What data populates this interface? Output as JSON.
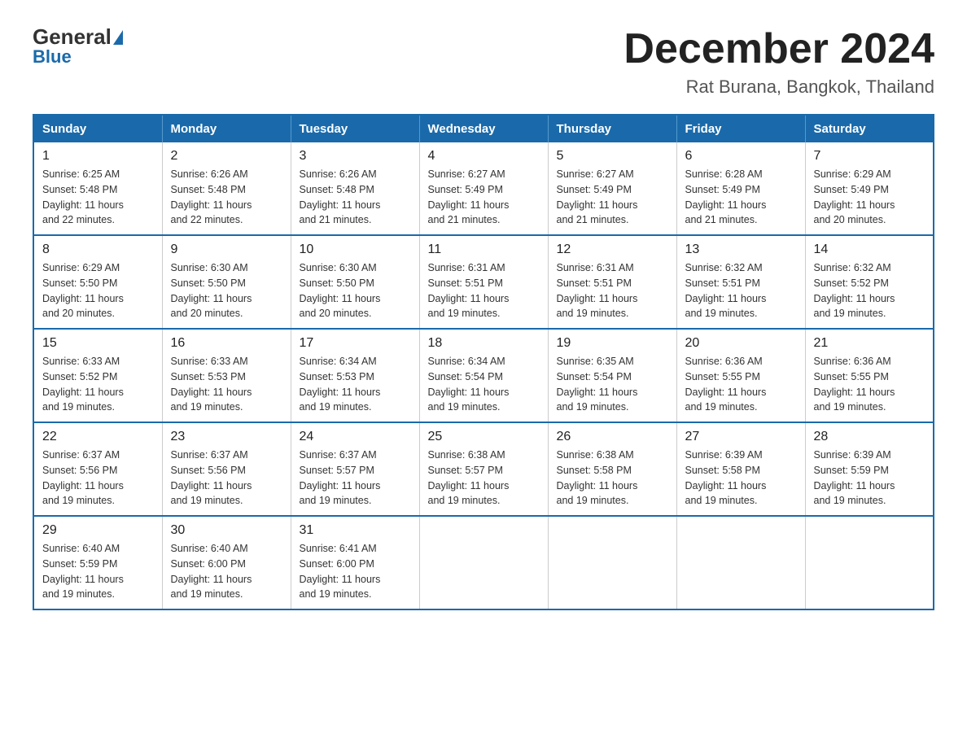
{
  "header": {
    "logo": {
      "general": "General",
      "blue": "Blue"
    },
    "title": "December 2024",
    "location": "Rat Burana, Bangkok, Thailand"
  },
  "calendar": {
    "days_of_week": [
      "Sunday",
      "Monday",
      "Tuesday",
      "Wednesday",
      "Thursday",
      "Friday",
      "Saturday"
    ],
    "weeks": [
      [
        {
          "day": "1",
          "sunrise": "6:25 AM",
          "sunset": "5:48 PM",
          "daylight": "11 hours and 22 minutes."
        },
        {
          "day": "2",
          "sunrise": "6:26 AM",
          "sunset": "5:48 PM",
          "daylight": "11 hours and 22 minutes."
        },
        {
          "day": "3",
          "sunrise": "6:26 AM",
          "sunset": "5:48 PM",
          "daylight": "11 hours and 21 minutes."
        },
        {
          "day": "4",
          "sunrise": "6:27 AM",
          "sunset": "5:49 PM",
          "daylight": "11 hours and 21 minutes."
        },
        {
          "day": "5",
          "sunrise": "6:27 AM",
          "sunset": "5:49 PM",
          "daylight": "11 hours and 21 minutes."
        },
        {
          "day": "6",
          "sunrise": "6:28 AM",
          "sunset": "5:49 PM",
          "daylight": "11 hours and 21 minutes."
        },
        {
          "day": "7",
          "sunrise": "6:29 AM",
          "sunset": "5:49 PM",
          "daylight": "11 hours and 20 minutes."
        }
      ],
      [
        {
          "day": "8",
          "sunrise": "6:29 AM",
          "sunset": "5:50 PM",
          "daylight": "11 hours and 20 minutes."
        },
        {
          "day": "9",
          "sunrise": "6:30 AM",
          "sunset": "5:50 PM",
          "daylight": "11 hours and 20 minutes."
        },
        {
          "day": "10",
          "sunrise": "6:30 AM",
          "sunset": "5:50 PM",
          "daylight": "11 hours and 20 minutes."
        },
        {
          "day": "11",
          "sunrise": "6:31 AM",
          "sunset": "5:51 PM",
          "daylight": "11 hours and 19 minutes."
        },
        {
          "day": "12",
          "sunrise": "6:31 AM",
          "sunset": "5:51 PM",
          "daylight": "11 hours and 19 minutes."
        },
        {
          "day": "13",
          "sunrise": "6:32 AM",
          "sunset": "5:51 PM",
          "daylight": "11 hours and 19 minutes."
        },
        {
          "day": "14",
          "sunrise": "6:32 AM",
          "sunset": "5:52 PM",
          "daylight": "11 hours and 19 minutes."
        }
      ],
      [
        {
          "day": "15",
          "sunrise": "6:33 AM",
          "sunset": "5:52 PM",
          "daylight": "11 hours and 19 minutes."
        },
        {
          "day": "16",
          "sunrise": "6:33 AM",
          "sunset": "5:53 PM",
          "daylight": "11 hours and 19 minutes."
        },
        {
          "day": "17",
          "sunrise": "6:34 AM",
          "sunset": "5:53 PM",
          "daylight": "11 hours and 19 minutes."
        },
        {
          "day": "18",
          "sunrise": "6:34 AM",
          "sunset": "5:54 PM",
          "daylight": "11 hours and 19 minutes."
        },
        {
          "day": "19",
          "sunrise": "6:35 AM",
          "sunset": "5:54 PM",
          "daylight": "11 hours and 19 minutes."
        },
        {
          "day": "20",
          "sunrise": "6:36 AM",
          "sunset": "5:55 PM",
          "daylight": "11 hours and 19 minutes."
        },
        {
          "day": "21",
          "sunrise": "6:36 AM",
          "sunset": "5:55 PM",
          "daylight": "11 hours and 19 minutes."
        }
      ],
      [
        {
          "day": "22",
          "sunrise": "6:37 AM",
          "sunset": "5:56 PM",
          "daylight": "11 hours and 19 minutes."
        },
        {
          "day": "23",
          "sunrise": "6:37 AM",
          "sunset": "5:56 PM",
          "daylight": "11 hours and 19 minutes."
        },
        {
          "day": "24",
          "sunrise": "6:37 AM",
          "sunset": "5:57 PM",
          "daylight": "11 hours and 19 minutes."
        },
        {
          "day": "25",
          "sunrise": "6:38 AM",
          "sunset": "5:57 PM",
          "daylight": "11 hours and 19 minutes."
        },
        {
          "day": "26",
          "sunrise": "6:38 AM",
          "sunset": "5:58 PM",
          "daylight": "11 hours and 19 minutes."
        },
        {
          "day": "27",
          "sunrise": "6:39 AM",
          "sunset": "5:58 PM",
          "daylight": "11 hours and 19 minutes."
        },
        {
          "day": "28",
          "sunrise": "6:39 AM",
          "sunset": "5:59 PM",
          "daylight": "11 hours and 19 minutes."
        }
      ],
      [
        {
          "day": "29",
          "sunrise": "6:40 AM",
          "sunset": "5:59 PM",
          "daylight": "11 hours and 19 minutes."
        },
        {
          "day": "30",
          "sunrise": "6:40 AM",
          "sunset": "6:00 PM",
          "daylight": "11 hours and 19 minutes."
        },
        {
          "day": "31",
          "sunrise": "6:41 AM",
          "sunset": "6:00 PM",
          "daylight": "11 hours and 19 minutes."
        },
        null,
        null,
        null,
        null
      ]
    ]
  }
}
